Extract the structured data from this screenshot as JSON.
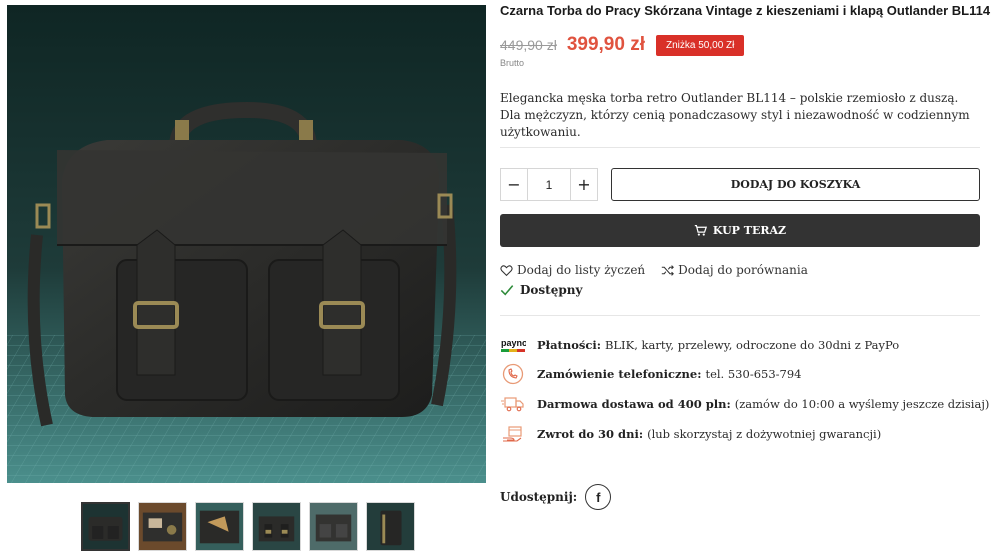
{
  "product": {
    "title": "Czarna Torba do Pracy Skórzana Vintage z kieszeniami i klapą Outlander BL114",
    "old_price": "449,90 zł",
    "new_price": "399,90 zł",
    "discount": "Zniżka 50,00 Zł",
    "tax_note": "Brutto",
    "description": "Elegancka męska torba retro Outlander BL114 – polskie rzemiosło z duszą. Dla mężczyzn, którzy cenią ponadczasowy styl i niezawodność w codziennym użytkowaniu."
  },
  "cart": {
    "minus": "−",
    "quantity": "1",
    "plus": "+",
    "add_to_cart": "DODAJ DO KOSZYKA",
    "buy_now": "KUP TERAZ"
  },
  "actions": {
    "wishlist": "Dodaj do listy życzeń",
    "compare": "Dodaj do porównania",
    "availability": "Dostępny"
  },
  "features": [
    {
      "icon": "paynow-logo",
      "label": "Płatności",
      "text": "BLIK, karty, przelewy, odroczone do 30dni z PayPo"
    },
    {
      "icon": "phone-order-icon",
      "label": "Zamówienie telefoniczne",
      "text": "tel. 530-653-794"
    },
    {
      "icon": "delivery-truck-icon",
      "label": "Darmowa dostawa od 400 pln",
      "text": "(zamów do 10:00 a wyślemy jeszcze dzisiaj)"
    },
    {
      "icon": "return-box-icon",
      "label": "Zwrot do 30 dni",
      "text": "(lub skorzystaj z dożywotniej gwarancji)"
    }
  ],
  "feature_colon": ":",
  "share": {
    "label": "Udostępnij:",
    "facebook": "f"
  },
  "gallery": {
    "thumbnail_count": 6,
    "active_index": 0
  },
  "colors": {
    "price": "#e0533f",
    "discount_bg": "#d93028",
    "dark_button": "#333333",
    "check": "#2e8b3a"
  }
}
